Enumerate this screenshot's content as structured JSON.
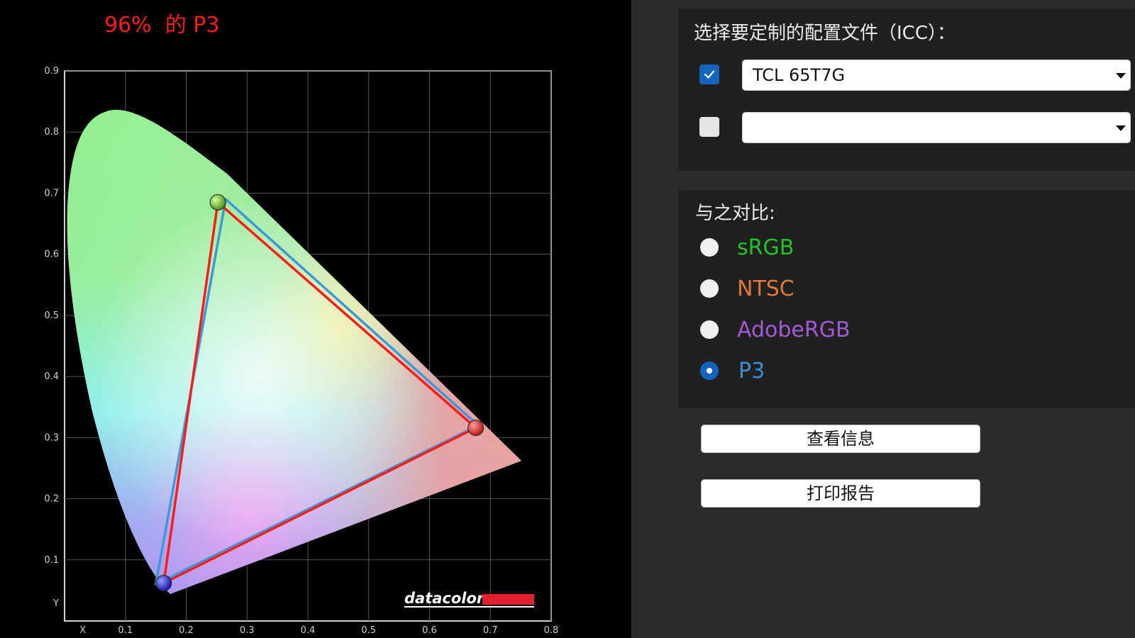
{
  "chart": {
    "title": "96%  的 P3"
  },
  "chart_data": {
    "type": "scatter",
    "subtype": "cie-1931-xy-gamut-comparison",
    "title": "96%  的 P3",
    "xlabel": "X",
    "ylabel": "Y",
    "xlim": [
      0,
      0.8
    ],
    "ylim": [
      0,
      0.9
    ],
    "x_ticks": [
      "0.1",
      "0.2",
      "0.3",
      "0.4",
      "0.5",
      "0.6",
      "0.7",
      "0.8"
    ],
    "y_ticks": [
      "0.1",
      "0.2",
      "0.3",
      "0.4",
      "0.5",
      "0.6",
      "0.7",
      "0.8",
      "0.9"
    ],
    "grid": true,
    "series": [
      {
        "color": "#ff1a1a",
        "points": [
          {
            "x": 0.676,
            "y": 0.316
          },
          {
            "x": 0.252,
            "y": 0.685
          },
          {
            "x": 0.163,
            "y": 0.062
          }
        ]
      },
      {
        "color": "#3a9ad9",
        "points": [
          {
            "x": 0.68,
            "y": 0.32
          },
          {
            "x": 0.265,
            "y": 0.69
          },
          {
            "x": 0.15,
            "y": 0.06
          }
        ]
      }
    ],
    "watermark": "datacolor"
  },
  "profile": {
    "title": "选择要定制的配置文件（ICC）：",
    "select1_value": "TCL 65T7G",
    "select2_value": ""
  },
  "compare": {
    "title": "与之对比:",
    "options": [
      {
        "label": "sRGB",
        "color": "#22c322",
        "selected": false
      },
      {
        "label": "NTSC",
        "color": "#e0783a",
        "selected": false
      },
      {
        "label": "AdobeRGB",
        "color": "#a45ad6",
        "selected": false
      },
      {
        "label": "P3",
        "color": "#3a8fd6",
        "selected": true
      }
    ]
  },
  "buttons": {
    "view_info": "查看信息",
    "print_report": "打印报告"
  },
  "colors": {
    "accent": "#1565c0",
    "title_red": "#ff1a1a"
  }
}
